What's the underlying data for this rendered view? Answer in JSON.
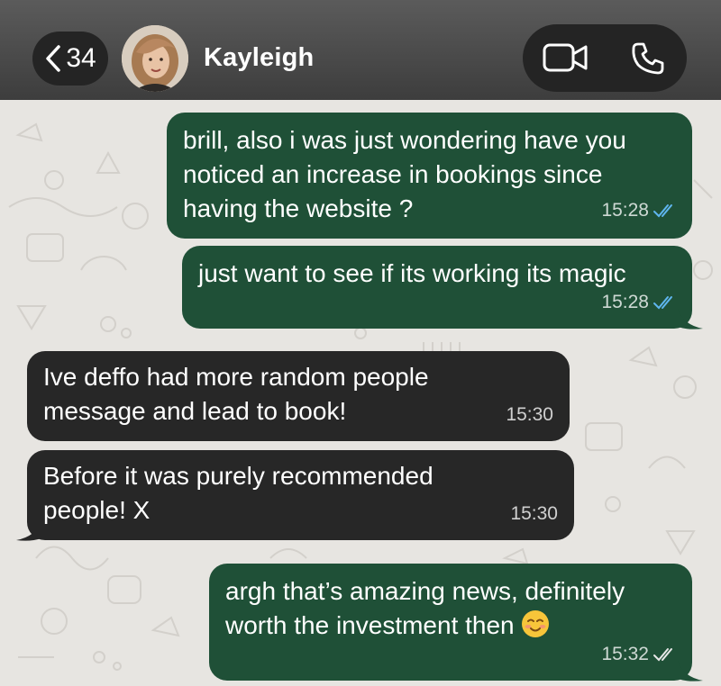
{
  "header": {
    "back_count": "34",
    "contact_name": "Kayleigh"
  },
  "messages": [
    {
      "direction": "outgoing",
      "lines": [
        "brill, also i was just wondering have you",
        "noticed an increase in bookings since",
        "having the website ?"
      ],
      "time": "15:28",
      "status": "read"
    },
    {
      "direction": "outgoing",
      "lines": [
        "just want to see if its working its magic"
      ],
      "time": "15:28",
      "status": "read"
    },
    {
      "direction": "incoming",
      "lines": [
        "Ive deffo had more random people",
        "message and lead to book!"
      ],
      "time": "15:30"
    },
    {
      "direction": "incoming",
      "lines": [
        "Before it was purely recommended",
        "people! X"
      ],
      "time": "15:30"
    },
    {
      "direction": "outgoing",
      "lines": [
        "argh that’s amazing news, definitely",
        "worth the investment then"
      ],
      "emoji": "smiling-face-icon",
      "time": "15:32",
      "status": "delivered"
    }
  ],
  "colors": {
    "outgoing_bubble": "#1f5037",
    "incoming_bubble": "#272727",
    "read_ticks": "#5fb6ef",
    "delivered_ticks": "#e8e8e8"
  }
}
